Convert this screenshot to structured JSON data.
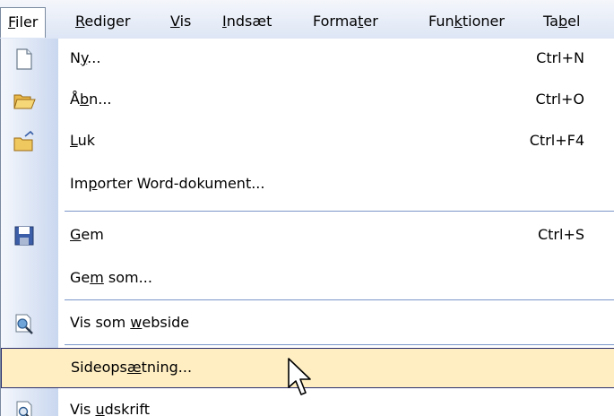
{
  "menubar": {
    "items": [
      {
        "pre": "",
        "ul": "F",
        "post": "iler"
      },
      {
        "pre": "",
        "ul": "R",
        "post": "ediger"
      },
      {
        "pre": "",
        "ul": "V",
        "post": "is"
      },
      {
        "pre": "",
        "ul": "I",
        "post": "ndsæt"
      },
      {
        "pre": "Forma",
        "ul": "t",
        "post": "er"
      },
      {
        "pre": "Fun",
        "ul": "k",
        "post": "tioner"
      },
      {
        "pre": "Ta",
        "ul": "b",
        "post": "el"
      }
    ]
  },
  "menu": {
    "items": [
      {
        "icon": "new-document-icon",
        "pre": "N",
        "ul": "y",
        "post": "...",
        "shortcut": "Ctrl+N"
      },
      {
        "icon": "open-folder-icon",
        "pre": "Å",
        "ul": "b",
        "post": "n...",
        "shortcut": "Ctrl+O"
      },
      {
        "icon": "close-folder-icon",
        "pre": "",
        "ul": "L",
        "post": "uk",
        "shortcut": "Ctrl+F4"
      },
      {
        "icon": "",
        "pre": "Im",
        "ul": "p",
        "post": "orter Word-dokument...",
        "shortcut": ""
      },
      {
        "icon": "save-disk-icon",
        "pre": "",
        "ul": "G",
        "post": "em",
        "shortcut": "Ctrl+S"
      },
      {
        "icon": "",
        "pre": "Ge",
        "ul": "m",
        "post": " som...",
        "shortcut": ""
      },
      {
        "icon": "web-preview-icon",
        "pre": "Vis som ",
        "ul": "w",
        "post": "ebside",
        "shortcut": ""
      },
      {
        "icon": "",
        "pre": "Sideops",
        "ul": "æ",
        "post": "tning...",
        "shortcut": ""
      },
      {
        "icon": "print-preview-icon",
        "pre": "Vis ",
        "ul": "u",
        "post": "dskrift",
        "shortcut": ""
      }
    ]
  }
}
